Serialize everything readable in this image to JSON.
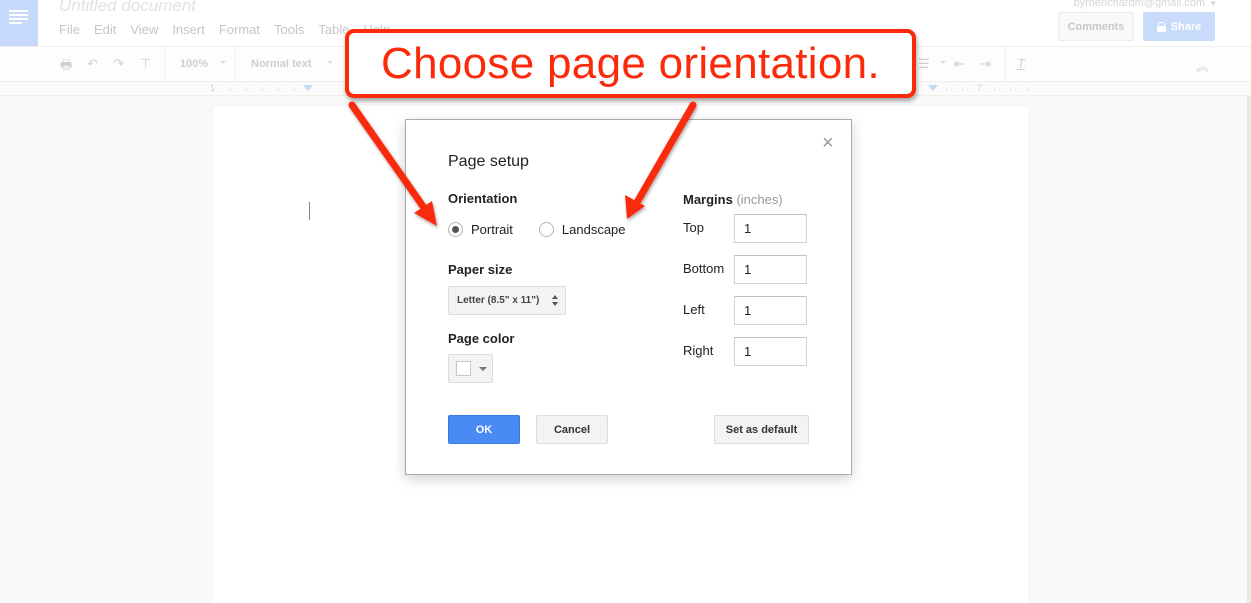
{
  "app": {
    "doc_title": "Untitled document",
    "account_email": "byrnerichardm@gmail.com",
    "menu": [
      "File",
      "Edit",
      "View",
      "Insert",
      "Format",
      "Tools",
      "Table",
      "Help"
    ],
    "comments_label": "Comments",
    "share_label": "Share"
  },
  "toolbar": {
    "zoom": "100%",
    "style": "Normal text"
  },
  "ruler": {
    "left_number": "1",
    "right_number": "7"
  },
  "dialog": {
    "title": "Page setup",
    "close_icon": "close-icon",
    "orientation_label": "Orientation",
    "orientation_options": [
      {
        "label": "Portrait",
        "selected": true
      },
      {
        "label": "Landscape",
        "selected": false
      }
    ],
    "paper_size_label": "Paper size",
    "paper_size_value": "Letter (8.5\" x 11\")",
    "page_color_label": "Page color",
    "page_color_value": "#ffffff",
    "margins_label": "Margins",
    "margins_unit": "(inches)",
    "margins": [
      {
        "label": "Top",
        "value": "1"
      },
      {
        "label": "Bottom",
        "value": "1"
      },
      {
        "label": "Left",
        "value": "1"
      },
      {
        "label": "Right",
        "value": "1"
      }
    ],
    "ok_label": "OK",
    "cancel_label": "Cancel",
    "set_default_label": "Set as default"
  },
  "annotation": {
    "text": "Choose page orientation.",
    "color": "#fa2a0a"
  }
}
